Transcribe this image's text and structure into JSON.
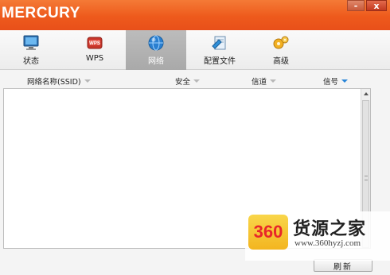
{
  "app": {
    "brand": "MERCURY"
  },
  "window_controls": {
    "minimize": "-",
    "close": "x"
  },
  "toolbar": {
    "items": [
      {
        "label": "状态",
        "icon": "monitor-icon"
      },
      {
        "label": "WPS",
        "icon": "wps-icon"
      },
      {
        "label": "网络",
        "icon": "globe-icon",
        "active": true
      },
      {
        "label": "配置文件",
        "icon": "config-file-icon"
      },
      {
        "label": "高级",
        "icon": "gears-icon"
      }
    ]
  },
  "network_list": {
    "columns": [
      "网络名称(SSID)",
      "安全",
      "信道",
      "信号"
    ],
    "sorted_column": "信号",
    "rows": []
  },
  "actions": {
    "refresh": "刷新"
  },
  "watermark": {
    "badge": "360",
    "title": "货源之家",
    "url": "www.360hyzj.com"
  },
  "colors": {
    "titlebar": "#ee5a1c",
    "accent_blue": "#2a86d8",
    "active_tab": "#a9a9a9"
  }
}
